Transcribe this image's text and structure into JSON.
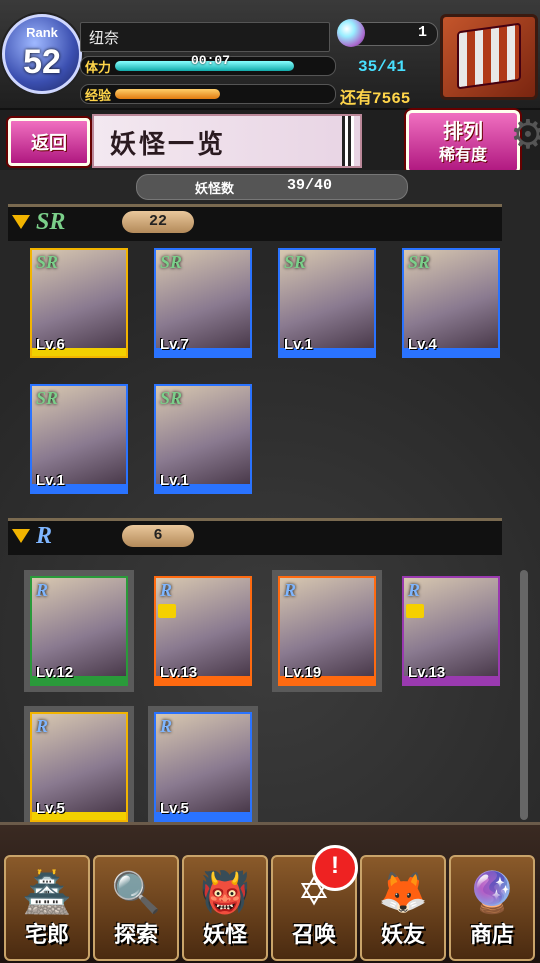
{
  "hud": {
    "rank_label": "Rank",
    "rank_value": "52",
    "player_name": "纽奈",
    "stamina_label": "体力",
    "stamina_timer": "00:07",
    "stamina_count": "35/41",
    "stamina_fraction": 0.85,
    "exp_label": "经验",
    "exp_remaining": "还有7565",
    "exp_fraction": 0.5,
    "orb_count": "1"
  },
  "titlebar": {
    "back_label": "返回",
    "title": "妖怪一览",
    "sort_label": "排列",
    "sort_sub": "稀有度"
  },
  "list": {
    "count_label": "妖怪数",
    "count_value": "39/40",
    "sections": [
      {
        "rarity": "SR",
        "count": "22",
        "color": "#7bd08a"
      },
      {
        "rarity": "R",
        "count": "6",
        "color": "#7fb6ff"
      }
    ],
    "cards": {
      "sr": [
        {
          "rarity": "SR",
          "level": "Lv.6",
          "frame": "#f2b400",
          "band": "#f2d000"
        },
        {
          "rarity": "SR",
          "level": "Lv.7",
          "frame": "#2a73ff",
          "band": "#2a73ff"
        },
        {
          "rarity": "SR",
          "level": "Lv.1",
          "frame": "#2a73ff",
          "band": "#2a73ff"
        },
        {
          "rarity": "SR",
          "level": "Lv.4",
          "frame": "#2a73ff",
          "band": "#2a73ff"
        },
        {
          "rarity": "SR",
          "level": "Lv.1",
          "frame": "#2a73ff",
          "band": "#2a73ff"
        },
        {
          "rarity": "SR",
          "level": "Lv.1",
          "frame": "#2a73ff",
          "band": "#2a73ff"
        }
      ],
      "r": [
        {
          "rarity": "R",
          "level": "Lv.12",
          "frame": "#2a9a3a",
          "band": "#2a9a3a"
        },
        {
          "rarity": "R",
          "level": "Lv.13",
          "frame": "#ff6a10",
          "band": "#ff6a10"
        },
        {
          "rarity": "R",
          "level": "Lv.19",
          "frame": "#ff6a10",
          "band": "#ff6a10"
        },
        {
          "rarity": "R",
          "level": "Lv.13",
          "frame": "#9a3ab0",
          "band": "#9a3ab0"
        },
        {
          "rarity": "R",
          "level": "Lv.5",
          "frame": "#f2b400",
          "band": "#f2d000"
        },
        {
          "rarity": "R",
          "level": "Lv.5",
          "frame": "#2a73ff",
          "band": "#2a73ff"
        }
      ]
    }
  },
  "nav": {
    "items": [
      {
        "label": "宅郎",
        "glyph": "🏯"
      },
      {
        "label": "探索",
        "glyph": "🔍"
      },
      {
        "label": "妖怪",
        "glyph": "👹"
      },
      {
        "label": "召唤",
        "glyph": "✡"
      },
      {
        "label": "妖友",
        "glyph": "🦊"
      },
      {
        "label": "商店",
        "glyph": "🔮"
      }
    ],
    "alert": "!"
  }
}
